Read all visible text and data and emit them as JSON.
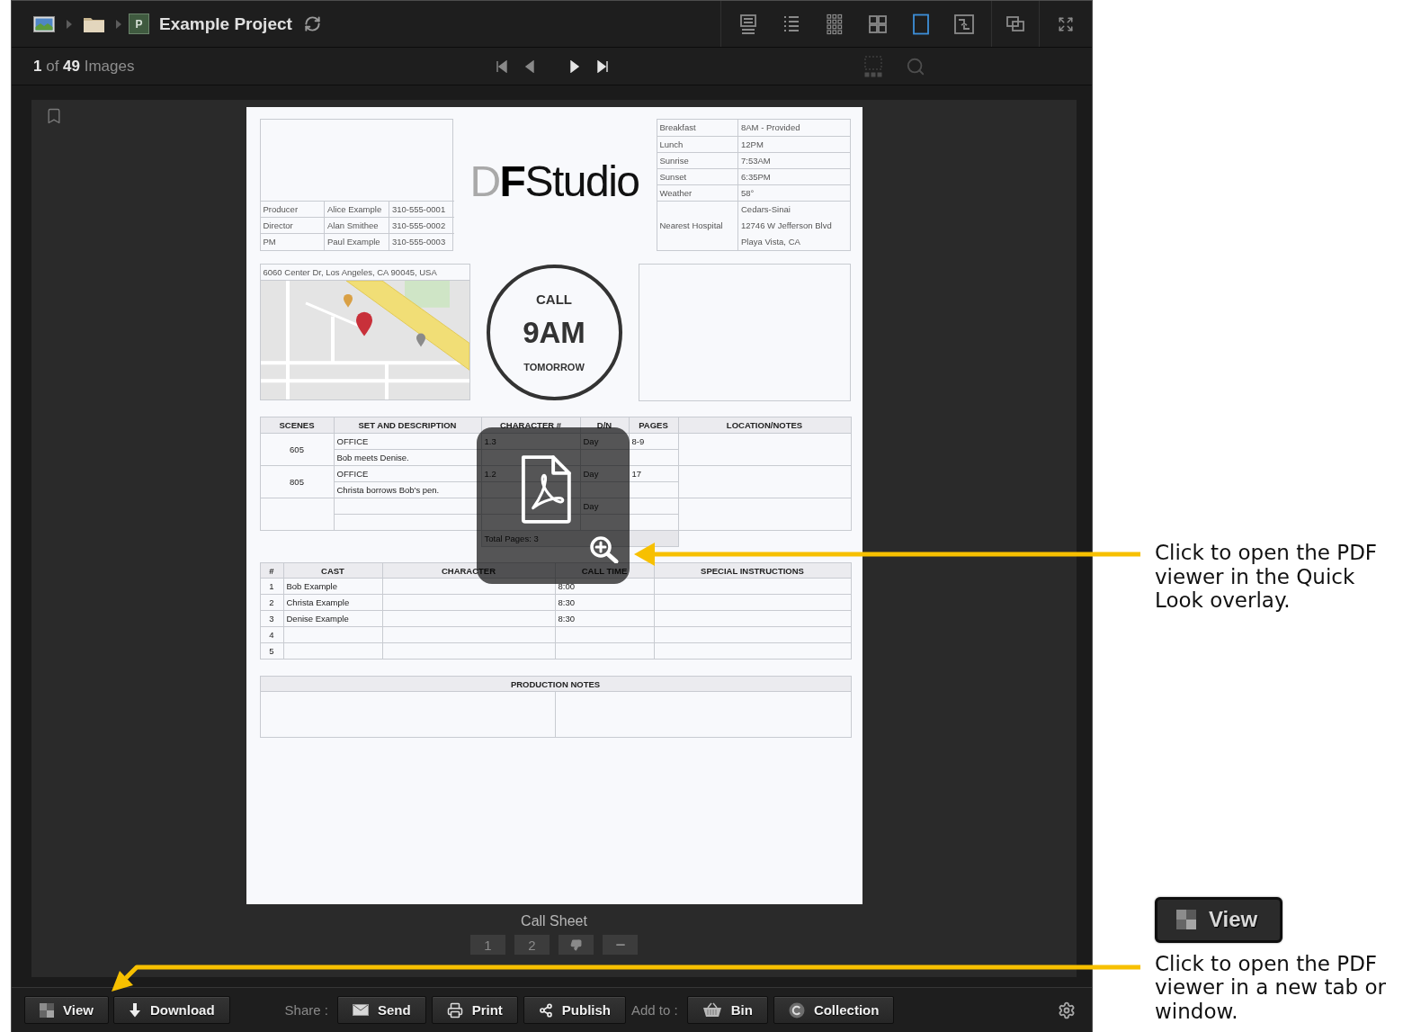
{
  "header": {
    "breadcrumb": [
      {
        "kind": "image"
      },
      {
        "kind": "folder"
      },
      {
        "kind": "project",
        "initial": "P",
        "title": "Example Project"
      }
    ],
    "view_modes": [
      {
        "kind": "detail",
        "selected": false
      },
      {
        "kind": "list",
        "selected": false
      },
      {
        "kind": "thumbnails",
        "selected": false
      },
      {
        "kind": "grid",
        "selected": false
      },
      {
        "kind": "single",
        "selected": true
      },
      {
        "kind": "compare",
        "selected": false
      }
    ]
  },
  "subbar": {
    "counter": "**1** of **49** Images",
    "navigation": [
      {
        "kind": "first",
        "disabled": true
      },
      {
        "kind": "previous",
        "disabled": true
      },
      {
        "kind": "next",
        "disabled": false
      },
      {
        "kind": "last",
        "disabled": false
      }
    ],
    "tools": [
      {
        "kind": "select",
        "disabled": true
      },
      {
        "kind": "search",
        "disabled": true
      }
    ]
  },
  "document": {
    "crew": [
      {
        "role": "Producer",
        "name": "Alice Example",
        "phone": "310-555-0001"
      },
      {
        "role": "Director",
        "name": "Alan Smithee",
        "phone": "310-555-0002"
      },
      {
        "role": "PM",
        "name": "Paul Example",
        "phone": "310-555-0003"
      }
    ],
    "logo": {
      "letters": [
        "D",
        "F"
      ],
      "word": "Studio"
    },
    "schedule": [
      {
        "label": "Breakfast",
        "value": "8AM - Provided"
      },
      {
        "label": "Lunch",
        "value": "12PM"
      },
      {
        "label": "Sunrise",
        "value": "7:53AM"
      },
      {
        "label": "Sunset",
        "value": "6:35PM"
      },
      {
        "label": "Weather",
        "value": "58°"
      }
    ],
    "hospital": {
      "label": "Nearest Hospital",
      "lines": [
        "Cedars-Sinai",
        "12746 W Jefferson Blvd",
        "Playa Vista, CA"
      ]
    },
    "location": {
      "address": "6060 Center Dr, Los Angeles, CA 90045, USA"
    },
    "call": {
      "label": "CALL",
      "time": "9AM",
      "day": "TOMORROW"
    },
    "scenes": {
      "columns": [
        "SCENES",
        "SET AND DESCRIPTION",
        "CHARACTER #",
        "D/N",
        "PAGES",
        "LOCATION/NOTES"
      ],
      "rows": [
        {
          "scene": "605",
          "set": "OFFICE",
          "description": "Bob meets Denise.",
          "characters": "1.3",
          "day_night": "Day",
          "pages": "8-9"
        },
        {
          "scene": "805",
          "set": "OFFICE",
          "description": "Christa borrows Bob's pen.",
          "characters": "1.2",
          "day_night": "Day",
          "pages": "17"
        },
        {
          "day_night": "Day"
        }
      ],
      "total": "Total Pages: 3"
    },
    "cast": {
      "columns": [
        "#",
        "CAST",
        "CHARACTER",
        "CALL TIME",
        "SPECIAL INSTRUCTIONS"
      ],
      "rows": [
        {
          "number": "1",
          "name": "Bob Example",
          "call_time": "8:00"
        },
        {
          "number": "2",
          "name": "Christa Example",
          "call_time": "8:30"
        },
        {
          "number": "3",
          "name": "Denise Example",
          "call_time": "8:30"
        },
        {
          "number": "4"
        },
        {
          "number": "5"
        }
      ]
    },
    "notes": {
      "title": "PRODUCTION NOTES"
    }
  },
  "caption": "Call Sheet",
  "pager": [
    {
      "kind": "page",
      "label": "1"
    },
    {
      "kind": "page",
      "label": "2"
    },
    {
      "kind": "reject"
    },
    {
      "kind": "clear"
    }
  ],
  "actions": {
    "primary": [
      {
        "kind": "view",
        "label": "View"
      },
      {
        "kind": "download",
        "label": "Download"
      }
    ],
    "share_label": "Share :",
    "share": [
      {
        "kind": "send",
        "label": "Send"
      },
      {
        "kind": "print",
        "label": "Print"
      },
      {
        "kind": "publish",
        "label": "Publish"
      }
    ],
    "add_label": "Add to :",
    "add": [
      {
        "kind": "bin",
        "label": "Bin"
      },
      {
        "kind": "collection",
        "label": "Collection"
      }
    ]
  },
  "annotations": {
    "overlay_note": "Click to open the PDF viewer in the Quick Look overlay.",
    "view_button": "View",
    "new_tab_note": "Click to open the PDF viewer in a new tab or window."
  }
}
